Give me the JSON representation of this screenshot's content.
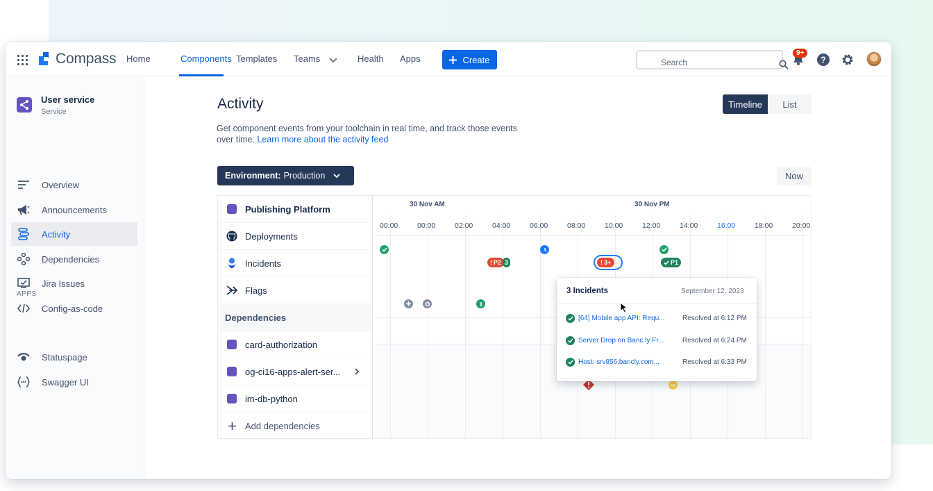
{
  "nav": {
    "logo": "Compass",
    "items": [
      "Home",
      "Components",
      "Templates",
      "Teams",
      "Health",
      "Apps"
    ],
    "create_label": "Create",
    "search_placeholder": "Search",
    "notification_badge": "9+"
  },
  "sidebar": {
    "component_name": "User service",
    "component_type": "Service",
    "items": [
      {
        "label": "Overview",
        "icon": "lines-icon"
      },
      {
        "label": "Announcements",
        "icon": "megaphone-icon"
      },
      {
        "label": "Activity",
        "icon": "activity-icon"
      },
      {
        "label": "Dependencies",
        "icon": "dependencies-icon"
      },
      {
        "label": "Jira Issues",
        "icon": "jira-issues-icon"
      },
      {
        "label": "Config-as-code",
        "icon": "code-icon"
      }
    ],
    "apps_label": "APPS",
    "apps": [
      {
        "label": "Statuspage",
        "icon": "statuspage-icon"
      },
      {
        "label": "Swagger UI",
        "icon": "swagger-icon"
      }
    ]
  },
  "main": {
    "title": "Activity",
    "desc_text": "Get component events from your toolchain in real time, and track those events over time.",
    "desc_link": "Learn more about the activity feed",
    "view_toggle": {
      "timeline": "Timeline",
      "list": "List"
    },
    "env_label": "Environment:",
    "env_value": "Production",
    "now_label": "Now"
  },
  "timeline": {
    "rows": [
      "Publishing Platform",
      "Deployments",
      "Incidents",
      "Flags"
    ],
    "dependencies_label": "Dependencies",
    "dependencies": [
      "card-authorization",
      "og-ci16-apps-alert-ser...",
      "im-db-python"
    ],
    "add_dependencies": "Add dependencies",
    "date_labels": [
      "30 Nov AM",
      "30 Nov PM"
    ],
    "ticks": [
      "00:00",
      "00:00",
      "02:00",
      "04:00",
      "06:00",
      "08:00",
      "10:00",
      "12:00",
      "14:00",
      "16:00",
      "18:00",
      "20:00"
    ],
    "events": {
      "p2_pill": "P2",
      "p2_count": "3",
      "incident_group": "3+",
      "p1_pill": "P1"
    }
  },
  "popover": {
    "title": "3 Incidents",
    "date": "September 12, 2023",
    "rows": [
      {
        "title": "[64] Mobile app API: Requ...",
        "resolved": "Resolved at 6:12 PM"
      },
      {
        "title": "Server Drop on Banc.ly Fr...",
        "resolved": "Resolved at 6:24 PM"
      },
      {
        "title": "Host: srv856.bancly.com...",
        "resolved": "Resolved at 6:33 PM"
      }
    ]
  },
  "colors": {
    "brand_blue": "#0c66e4",
    "nav_dark": "#253858",
    "success_green": "#1f845a",
    "danger_red": "#de350b",
    "warning_yellow": "#f5cd47",
    "purple": "#6554c0"
  }
}
